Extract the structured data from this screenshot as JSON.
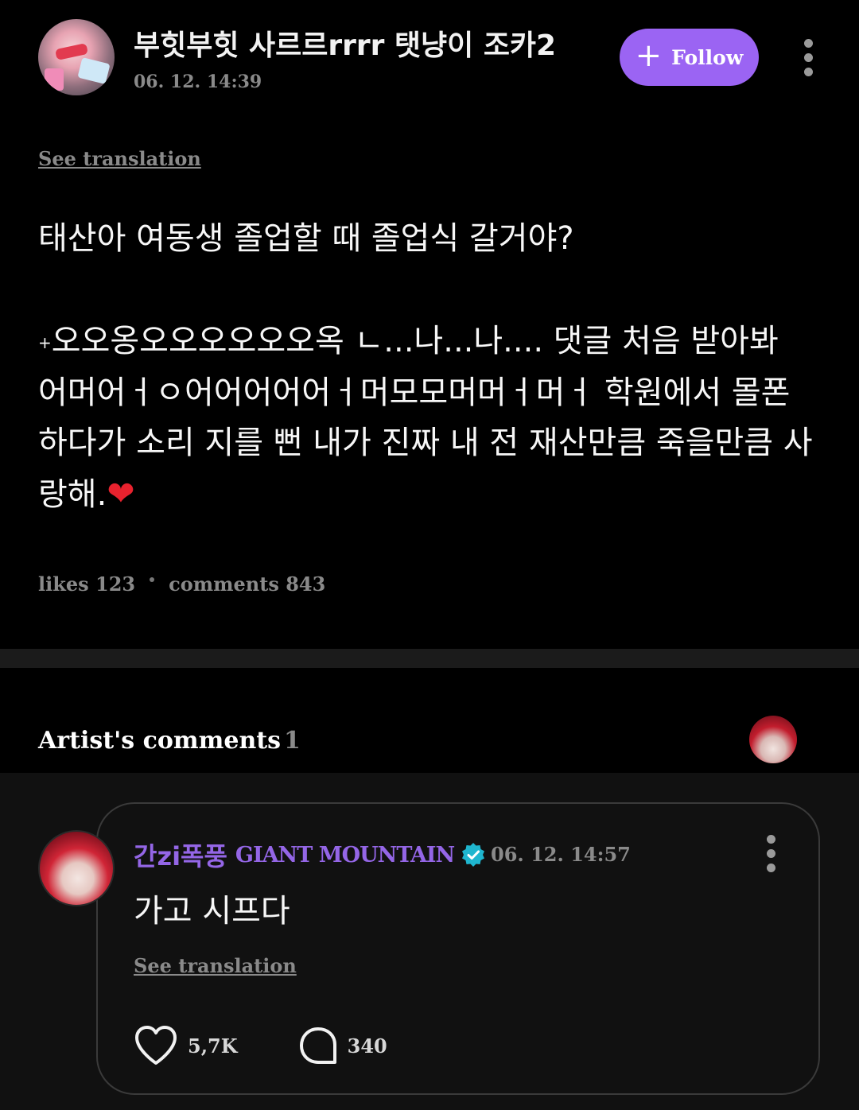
{
  "post": {
    "author_name": "부힛부힛 사르르rrrr 탯냥이 조카2",
    "timestamp": "06. 12. 14:39",
    "follow_label": "Follow",
    "see_translation": "See translation",
    "question": "태산아 여동생 졸업할 때 졸업식 갈거야?",
    "body_prefix": "+",
    "body": "오오옹오오오오오오옥 ㄴ...나...나.... 댓글 처음 받아봐 어머어ㅓㅇ어어어어어ㅓ머모모머머ㅓ머ㅓ 학원에서 몰폰 하다가 소리 지를 뻔 내가 진짜 내 전 재산만큼 죽을만큼 사랑해.",
    "emoji": "❤",
    "likes_label": "likes",
    "likes_count": "123",
    "comments_label": "comments",
    "comments_count": "843"
  },
  "artist_comments": {
    "title": "Artist's comments",
    "count": "1",
    "comment": {
      "author_name": "간zi폭풍",
      "group_name": "GIANT MOUNTAIN",
      "verified": true,
      "timestamp": "06. 12. 14:57",
      "text": "가고 시프다",
      "see_translation": "See translation",
      "likes": "5,7K",
      "replies": "340"
    }
  },
  "icons": {
    "follow": "plus-icon",
    "more": "kebab-menu-icon",
    "verified": "verified-badge-icon",
    "like": "heart-outline-icon",
    "reply": "speech-bubble-icon"
  },
  "colors": {
    "accent": "#9b64f3",
    "artist_name": "#9466e6",
    "verified_badge": "#1fb6cf",
    "background": "#000000",
    "muted_text": "#8a8a8a"
  }
}
